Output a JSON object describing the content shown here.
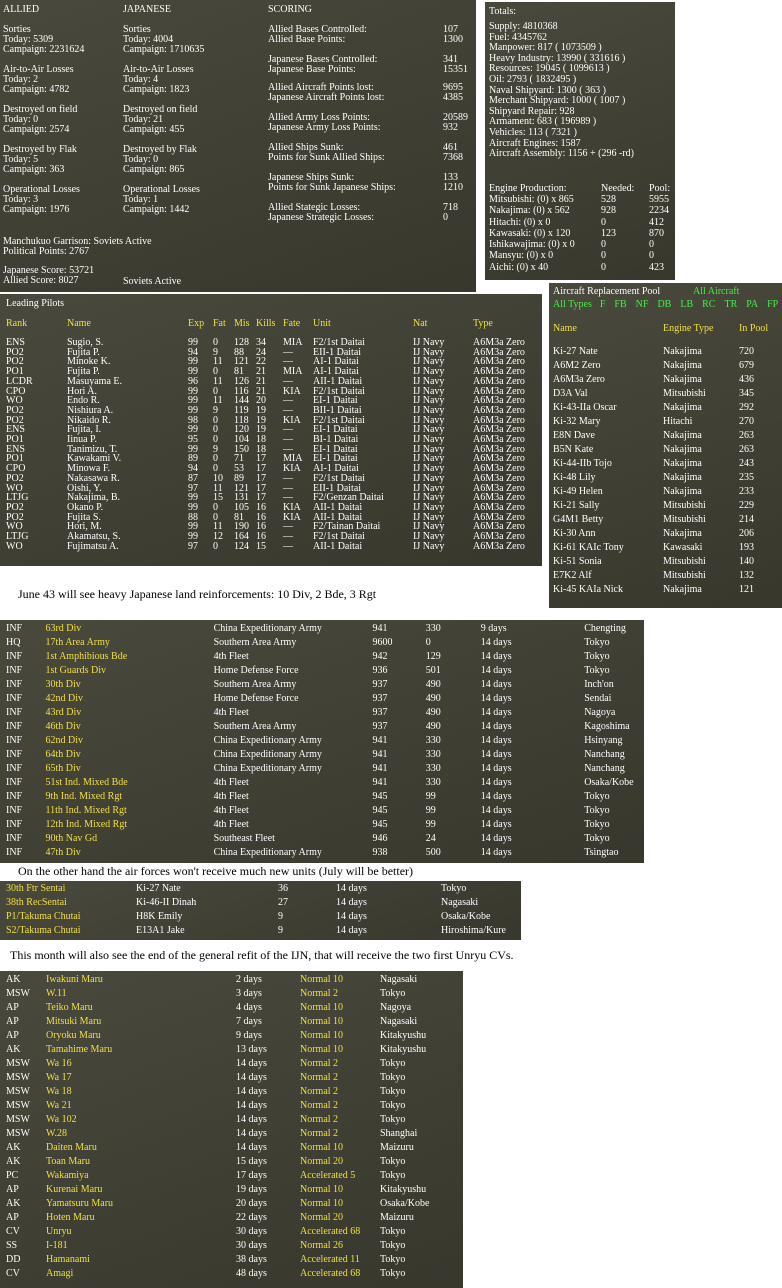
{
  "summary": {
    "allied": {
      "header": "ALLIED",
      "sorties": [
        "Sorties",
        "Today:     5309",
        "Campaign: 2231624"
      ],
      "a2a": [
        "Air-to-Air Losses",
        "Today:     2",
        "Campaign: 4782"
      ],
      "field": [
        "Destroyed on field",
        "Today:     0",
        "Campaign: 2574"
      ],
      "flak": [
        "Destroyed by Flak",
        "Today:     5",
        "Campaign: 363"
      ],
      "ops": [
        "Operational Losses",
        "Today:     3",
        "Campaign: 1976"
      ]
    },
    "japanese": {
      "header": "JAPANESE",
      "sorties": [
        "Sorties",
        "Today:     4004",
        "Campaign: 1710635"
      ],
      "a2a": [
        "Air-to-Air Losses",
        "Today:     4",
        "Campaign: 1823"
      ],
      "field": [
        "Destroyed on field",
        "Today:     21",
        "Campaign: 455"
      ],
      "flak": [
        "Destroyed by Flak",
        "Today:     0",
        "Campaign: 865"
      ],
      "ops": [
        "Operational Losses",
        "Today:     1",
        "Campaign: 1442"
      ]
    },
    "garrison": "Manchukuo Garrison: Soviets Active",
    "political": "Political Points: 2767",
    "japan_score": "Japanese Score: 53721",
    "allied_score": "Allied Score: 8027",
    "soviets": "Soviets Active",
    "scoring_header": "SCORING",
    "scoring": [
      {
        "l1": "Allied Bases Controlled:",
        "v1": "107",
        "l2": "Allied Base Points:",
        "v2": "1300"
      },
      {
        "l1": "Japanese Bases Controlled:",
        "v1": "341",
        "l2": "Japanese Base Points:",
        "v2": "15351"
      },
      {
        "l1": "Allied Aircraft Points lost:",
        "v1": "9695",
        "l2": "Japanese Aircraft Points lost:",
        "v2": "4385"
      },
      {
        "l1": "Allied Army Loss Points:",
        "v1": "20589",
        "l2": "Japanese Army Loss Points:",
        "v2": "932"
      },
      {
        "l1": "Allied Ships Sunk:",
        "v1": "461",
        "l2": "Points for Sunk Allied Ships:",
        "v2": "7368"
      },
      {
        "l1": "Japanese Ships Sunk:",
        "v1": "133",
        "l2": "Points for Sunk Japanese Ships:",
        "v2": "1210"
      },
      {
        "l1": "Allied Stategic Losses:",
        "v1": "718",
        "l2": "Japanese Strategic Losses:",
        "v2": "0"
      }
    ]
  },
  "totals": {
    "title": "Totals:",
    "lines": [
      "Supply: 4810368",
      "Fuel: 4345762",
      "Manpower: 817 ( 1073509 )",
      "Heavy Industry: 13990 ( 331616 )",
      "Resources: 19045 ( 1099613 )",
      "Oil: 2793 ( 1832495 )",
      "Naval Shipyard: 1300 ( 363 )",
      "Merchant Shipyard: 1000 ( 1007 )",
      "Shipyard Repair: 928",
      "Armament: 683 ( 196989 )",
      "Vehicles: 113 ( 7321 )",
      "Aircraft Engines: 1587",
      "Aircraft Assembly: 1156 + (296 -rd)"
    ],
    "engine_header": [
      "Engine Production:",
      "Needed:",
      "Pool:"
    ],
    "engines": [
      [
        "Mitsubishi:  (0) x 865",
        "528",
        "5955"
      ],
      [
        "Nakajima:  (0) x 562",
        "928",
        "2234"
      ],
      [
        "Hitachi:  (0) x 0",
        "0",
        "412"
      ],
      [
        "Kawasaki:  (0) x 120",
        "123",
        "870"
      ],
      [
        "Ishikawajima:  (0) x 0",
        "0",
        "0"
      ],
      [
        "Mansyu:  (0) x 0",
        "0",
        "0"
      ],
      [
        "Aichi:  (0) x 40",
        "0",
        "423"
      ]
    ]
  },
  "pool": {
    "title": "Aircraft Replacement Pool",
    "all": "All Aircraft",
    "filters": [
      "All Types",
      "F",
      "FB",
      "NF",
      "DB",
      "LB",
      "RC",
      "TR",
      "PA",
      "FP"
    ],
    "headers": [
      "Name",
      "Engine Type",
      "In Pool"
    ],
    "rows": [
      [
        "Ki-27 Nate",
        "Nakajima",
        "720"
      ],
      [
        "A6M2 Zero",
        "Nakajima",
        "679"
      ],
      [
        "A6M3a Zero",
        "Nakajima",
        "436"
      ],
      [
        "D3A Val",
        "Mitsubishi",
        "345"
      ],
      [
        "Ki-43-IIa Oscar",
        "Nakajima",
        "292"
      ],
      [
        "Ki-32 Mary",
        "Hitachi",
        "270"
      ],
      [
        "E8N Dave",
        "Nakajima",
        "263"
      ],
      [
        "B5N Kate",
        "Nakajima",
        "263"
      ],
      [
        "Ki-44-IIb Tojo",
        "Nakajima",
        "243"
      ],
      [
        "Ki-48 Lily",
        "Nakajima",
        "235"
      ],
      [
        "Ki-49 Helen",
        "Nakajima",
        "233"
      ],
      [
        "Ki-21 Sally",
        "Mitsubishi",
        "229"
      ],
      [
        "G4M1 Betty",
        "Mitsubishi",
        "214"
      ],
      [
        "Ki-30 Ann",
        "Nakajima",
        "206"
      ],
      [
        "Ki-61 KAIc Tony",
        "Kawasaki",
        "193"
      ],
      [
        "Ki-51 Sonia",
        "Mitsubishi",
        "140"
      ],
      [
        "E7K2 Alf",
        "Mitsubishi",
        "132"
      ],
      [
        "Ki-45 KAIa Nick",
        "Nakajima",
        "121"
      ]
    ]
  },
  "pilots": {
    "title": "Leading Pilots",
    "headers": [
      "Rank",
      "Name",
      "Exp",
      "Fat",
      "Mis",
      "Kills",
      "Fate",
      "Unit",
      "Nat",
      "Type"
    ],
    "rows": [
      [
        "ENS",
        "Sugio, S.",
        "99",
        "0",
        "128",
        "34",
        "MIA",
        "F2/1st Daitai",
        "IJ Navy",
        "A6M3a Zero"
      ],
      [
        "PO2",
        "Fujita P.",
        "94",
        "9",
        "88",
        "24",
        "—",
        "EII-1 Daitai",
        "IJ Navy",
        "A6M3a Zero"
      ],
      [
        "PO2",
        "Minoke K.",
        "99",
        "11",
        "121",
        "22",
        "—",
        "AI-1 Daitai",
        "IJ Navy",
        "A6M3a Zero"
      ],
      [
        "PO1",
        "Fujita P.",
        "99",
        "0",
        "81",
        "21",
        "MIA",
        "AI-1 Daitai",
        "IJ Navy",
        "A6M3a Zero"
      ],
      [
        "LCDR",
        "Masuyama E.",
        "96",
        "11",
        "126",
        "21",
        "—",
        "AII-1 Daitai",
        "IJ Navy",
        "A6M3a Zero"
      ],
      [
        "CPO",
        "Hori A.",
        "99",
        "0",
        "116",
        "21",
        "KIA",
        "F2/1st Daitai",
        "IJ Navy",
        "A6M3a Zero"
      ],
      [
        "WO",
        "Endo R.",
        "99",
        "11",
        "144",
        "20",
        "—",
        "EI-1 Daitai",
        "IJ Navy",
        "A6M3a Zero"
      ],
      [
        "PO2",
        "Nishiura A.",
        "99",
        "9",
        "119",
        "19",
        "—",
        "BII-1 Daitai",
        "IJ Navy",
        "A6M3a Zero"
      ],
      [
        "PO2",
        "Nikaido R.",
        "98",
        "0",
        "118",
        "19",
        "KIA",
        "F2/1st Daitai",
        "IJ Navy",
        "A6M3a Zero"
      ],
      [
        "ENS",
        "Fujita, I.",
        "99",
        "0",
        "120",
        "19",
        "—",
        "EI-1 Daitai",
        "IJ Navy",
        "A6M3a Zero"
      ],
      [
        "PO1",
        "Iinua P.",
        "95",
        "0",
        "104",
        "18",
        "—",
        "BI-1 Daitai",
        "IJ Navy",
        "A6M3a Zero"
      ],
      [
        "ENS",
        "Tanimizu, T.",
        "99",
        "9",
        "150",
        "18",
        "—",
        "EI-1 Daitai",
        "IJ Navy",
        "A6M3a Zero"
      ],
      [
        "PO1",
        "Kawakami V.",
        "89",
        "0",
        "71",
        "17",
        "MIA",
        "EI-1 Daitai",
        "IJ Navy",
        "A6M3a Zero"
      ],
      [
        "CPO",
        "Minowa F.",
        "94",
        "0",
        "53",
        "17",
        "KIA",
        "AI-1 Daitai",
        "IJ Navy",
        "A6M3a Zero"
      ],
      [
        "PO2",
        "Nakasawa R.",
        "87",
        "10",
        "89",
        "17",
        "—",
        "F2/1st Daitai",
        "IJ Navy",
        "A6M3a Zero"
      ],
      [
        "WO",
        "Oishi, Y.",
        "97",
        "11",
        "121",
        "17",
        "—",
        "EII-1 Daitai",
        "IJ Navy",
        "A6M3a Zero"
      ],
      [
        "LTJG",
        "Nakajima, B.",
        "99",
        "15",
        "131",
        "17",
        "—",
        "F2/Genzan Daitai",
        "IJ Navy",
        "A6M3a Zero"
      ],
      [
        "PO2",
        "Okano P.",
        "99",
        "0",
        "105",
        "16",
        "KIA",
        "AII-1 Daitai",
        "IJ Navy",
        "A6M3a Zero"
      ],
      [
        "PO2",
        "Fujita S.",
        "88",
        "0",
        "81",
        "16",
        "KIA",
        "AII-1 Daitai",
        "IJ Navy",
        "A6M3a Zero"
      ],
      [
        "WO",
        "Hori, M.",
        "99",
        "11",
        "190",
        "16",
        "—",
        "F2/Tainan Daitai",
        "IJ Navy",
        "A6M3a Zero"
      ],
      [
        "LTJG",
        "Akamatsu, S.",
        "99",
        "12",
        "164",
        "16",
        "—",
        "F2/1st Daitai",
        "IJ Navy",
        "A6M3a Zero"
      ],
      [
        "WO",
        "Fujimatsu A.",
        "97",
        "0",
        "124",
        "15",
        "—",
        "AII-1 Daitai",
        "IJ Navy",
        "A6M3a Zero"
      ]
    ]
  },
  "caption1": "June 43 will see heavy Japanese land reinforcements: 10 Div, 2 Bde, 3 Rgt",
  "land": [
    [
      "INF",
      "63rd Div",
      "China Expeditionary Army",
      "941",
      "330",
      "9 days",
      "Chengting"
    ],
    [
      "HQ",
      "17th Area Army",
      "Southern Area Army",
      "9600",
      "0",
      "14 days",
      "Tokyo"
    ],
    [
      "INF",
      "1st Amphibious Bde",
      "4th Fleet",
      "942",
      "129",
      "14 days",
      "Tokyo"
    ],
    [
      "INF",
      "1st Guards Div",
      "Home Defense Force",
      "936",
      "501",
      "14 days",
      "Tokyo"
    ],
    [
      "INF",
      "30th Div",
      "Southern Area Army",
      "937",
      "490",
      "14 days",
      "Inch'on"
    ],
    [
      "INF",
      "42nd Div",
      "Home Defense Force",
      "937",
      "490",
      "14 days",
      "Sendai"
    ],
    [
      "INF",
      "43rd Div",
      "4th Fleet",
      "937",
      "490",
      "14 days",
      "Nagoya"
    ],
    [
      "INF",
      "46th Div",
      "Southern Area Army",
      "937",
      "490",
      "14 days",
      "Kagoshima"
    ],
    [
      "INF",
      "62nd Div",
      "China Expeditionary Army",
      "941",
      "330",
      "14 days",
      "Hsinyang"
    ],
    [
      "INF",
      "64th Div",
      "China Expeditionary Army",
      "941",
      "330",
      "14 days",
      "Nanchang"
    ],
    [
      "INF",
      "65th Div",
      "China Expeditionary Army",
      "941",
      "330",
      "14 days",
      "Nanchang"
    ],
    [
      "INF",
      "51st Ind. Mixed Bde",
      "4th Fleet",
      "941",
      "330",
      "14 days",
      "Osaka/Kobe"
    ],
    [
      "INF",
      "9th Ind. Mixed Rgt",
      "4th Fleet",
      "945",
      "99",
      "14 days",
      "Tokyo"
    ],
    [
      "INF",
      "11th Ind. Mixed Rgt",
      "4th Fleet",
      "945",
      "99",
      "14 days",
      "Tokyo"
    ],
    [
      "INF",
      "12th Ind. Mixed Rgt",
      "4th Fleet",
      "945",
      "99",
      "14 days",
      "Tokyo"
    ],
    [
      "INF",
      "90th Nav Gd",
      "Southeast Fleet",
      "946",
      "24",
      "14 days",
      "Tokyo"
    ],
    [
      "INF",
      "47th Div",
      "China Expeditionary Army",
      "938",
      "500",
      "14 days",
      "Tsingtao"
    ]
  ],
  "caption2": "On the other hand the air forces won't receive much new units (July will be better)",
  "air": [
    [
      "30th Ftr Sentai",
      "Ki-27 Nate",
      "36",
      "14 days",
      "Tokyo"
    ],
    [
      "38th RecSentai",
      "Ki-46-II Dinah",
      "27",
      "14 days",
      "Nagasaki"
    ],
    [
      "P1/Takuma Chutai",
      "H8K Emily",
      "9",
      "14 days",
      "Osaka/Kobe"
    ],
    [
      "S2/Takuma Chutai",
      "E13A1 Jake",
      "9",
      "14 days",
      "Hiroshima/Kure"
    ]
  ],
  "caption3": "This month will also see the end of the general refit of the IJN, that will receive the two first Unryu CVs.",
  "ships": [
    [
      "AK",
      "Iwakuni Maru",
      "2 days",
      "Normal 10",
      "Nagasaki"
    ],
    [
      "MSW",
      "W.11",
      "3 days",
      "Normal 2",
      "Tokyo"
    ],
    [
      "AP",
      "Teiko Maru",
      "4 days",
      "Normal 10",
      "Nagoya"
    ],
    [
      "AP",
      "Mitsuki Maru",
      "7 days",
      "Normal 10",
      "Nagasaki"
    ],
    [
      "AP",
      "Oryoku Maru",
      "9 days",
      "Normal 10",
      "Kitakyushu"
    ],
    [
      "AK",
      "Tamahime Maru",
      "13 days",
      "Normal 10",
      "Kitakyushu"
    ],
    [
      "MSW",
      "Wa 16",
      "14 days",
      "Normal 2",
      "Tokyo"
    ],
    [
      "MSW",
      "Wa 17",
      "14 days",
      "Normal 2",
      "Tokyo"
    ],
    [
      "MSW",
      "Wa 18",
      "14 days",
      "Normal 2",
      "Tokyo"
    ],
    [
      "MSW",
      "Wa 21",
      "14 days",
      "Normal 2",
      "Tokyo"
    ],
    [
      "MSW",
      "Wa 102",
      "14 days",
      "Normal 2",
      "Tokyo"
    ],
    [
      "MSW",
      "W.28",
      "14 days",
      "Normal 2",
      "Shanghai"
    ],
    [
      "AK",
      "Daiten Maru",
      "14 days",
      "Normal 10",
      "Maizuru"
    ],
    [
      "AK",
      "Toan Maru",
      "15 days",
      "Normal 20",
      "Tokyo"
    ],
    [
      "PC",
      "Wakamiya",
      "17 days",
      "Accelerated 5",
      "Tokyo"
    ],
    [
      "AP",
      "Kurenai Maru",
      "19 days",
      "Normal 10",
      "Kitakyushu"
    ],
    [
      "AK",
      "Yamatsuru Maru",
      "20 days",
      "Normal 10",
      "Osaka/Kobe"
    ],
    [
      "AP",
      "Hoten Maru",
      "22 days",
      "Normal 20",
      "Maizuru"
    ],
    [
      "CV",
      "Unryu",
      "30 days",
      "Accelerated 68",
      "Tokyo"
    ],
    [
      "SS",
      "I-181",
      "30 days",
      "Normal 26",
      "Tokyo"
    ],
    [
      "DD",
      "Hamanami",
      "38 days",
      "Accelerated 11",
      "Tokyo"
    ],
    [
      "CV",
      "Amagi",
      "48 days",
      "Accelerated 68",
      "Tokyo"
    ]
  ]
}
